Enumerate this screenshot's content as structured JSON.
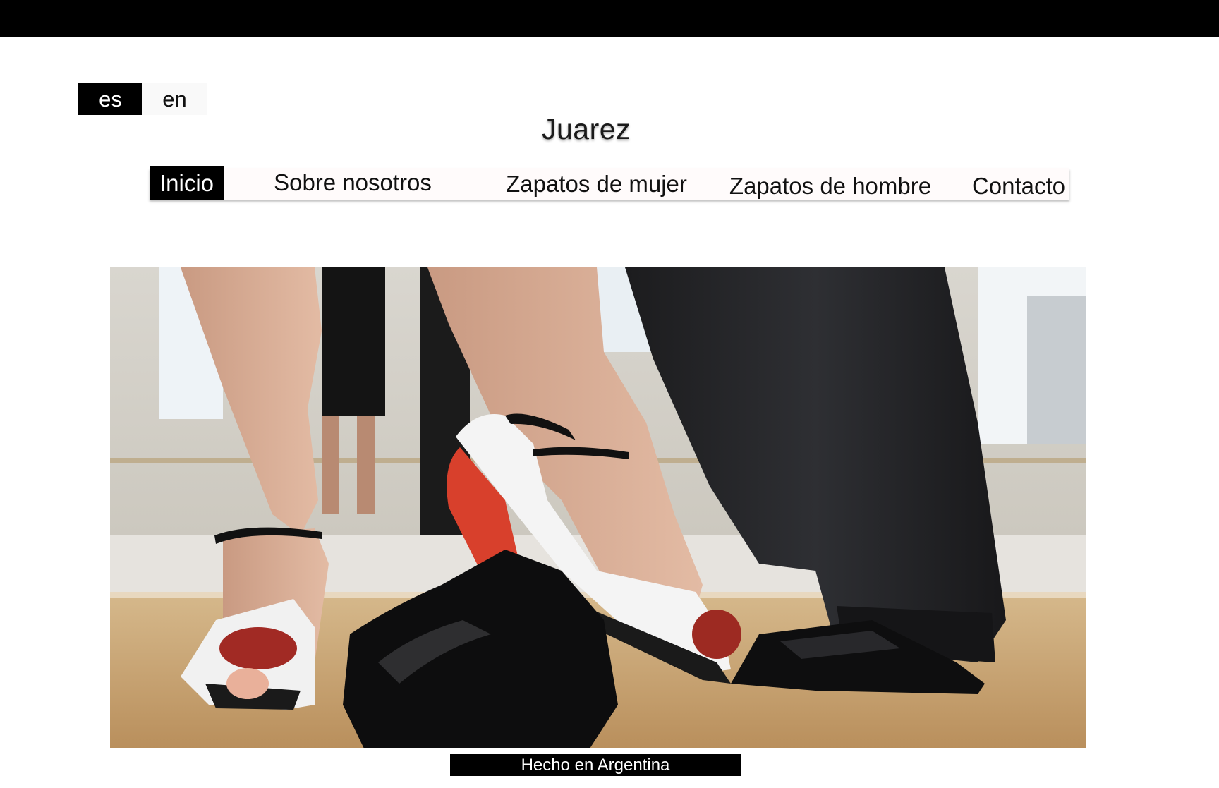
{
  "site": {
    "brand": "Juarez"
  },
  "language": {
    "options": [
      "es",
      "en"
    ],
    "selected": "es"
  },
  "nav": {
    "items": [
      "Inicio",
      "Sobre nosotros",
      "Zapatos de mujer",
      "Zapatos de hombre",
      "Contacto"
    ],
    "active": "Inicio"
  },
  "hero": {
    "caption": "Hecho en Argentina"
  },
  "colors": {
    "topbar": "#000000",
    "active_bg": "#000000",
    "active_text": "#ffffff",
    "nav_bg": "#fffbfb",
    "heel_red": "#d8402c"
  }
}
